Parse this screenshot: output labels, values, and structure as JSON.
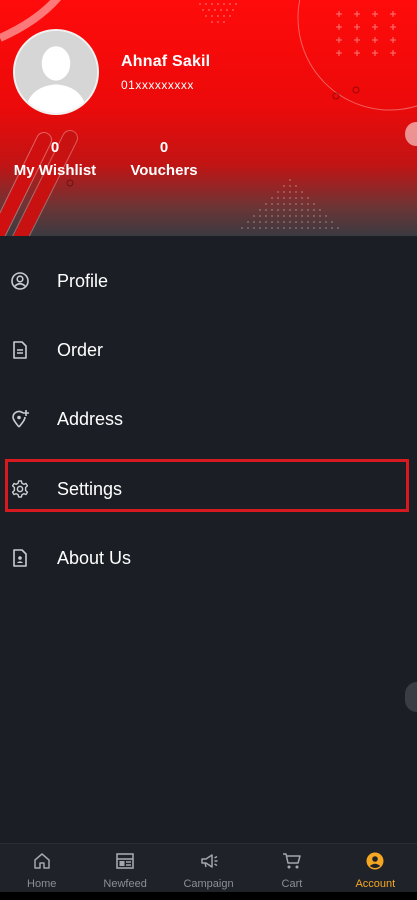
{
  "profile": {
    "name": "Ahnaf Sakil",
    "phone": "01xxxxxxxxx"
  },
  "stats": {
    "wishlist": {
      "count": "0",
      "label": "My Wishlist"
    },
    "vouchers": {
      "count": "0",
      "label": "Vouchers"
    }
  },
  "menu": {
    "items": [
      {
        "label": "Profile",
        "icon": "user-circle-icon"
      },
      {
        "label": "Order",
        "icon": "document-icon"
      },
      {
        "label": "Address",
        "icon": "location-add-icon"
      },
      {
        "label": "Settings",
        "icon": "gear-icon"
      },
      {
        "label": "About Us",
        "icon": "contact-card-icon"
      }
    ]
  },
  "bottom_nav": {
    "items": [
      {
        "label": "Home",
        "icon": "home-icon"
      },
      {
        "label": "Newfeed",
        "icon": "newspaper-icon"
      },
      {
        "label": "Campaign",
        "icon": "megaphone-icon"
      },
      {
        "label": "Cart",
        "icon": "cart-icon"
      },
      {
        "label": "Account",
        "icon": "account-icon",
        "active": true
      }
    ]
  },
  "colors": {
    "header_red": "#ff0b0b",
    "background": "#1b1f25",
    "active_tab": "#f5a623",
    "highlight": "#d71920"
  }
}
